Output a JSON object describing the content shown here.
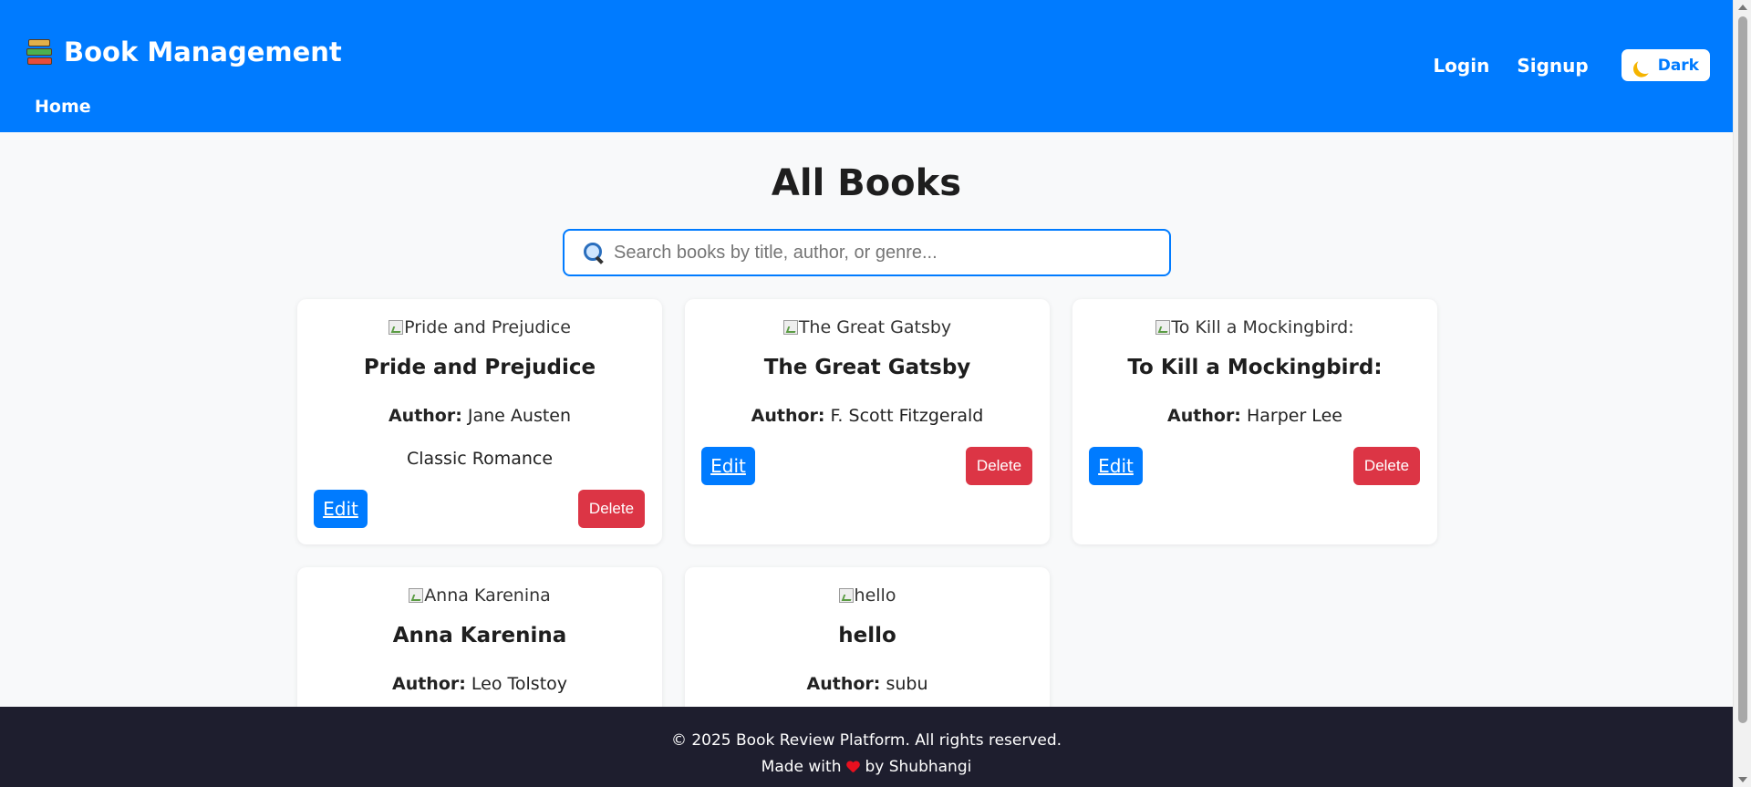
{
  "header": {
    "brand": "Book Management",
    "nav_home": "Home",
    "login": "Login",
    "signup": "Signup",
    "theme_toggle": "Dark",
    "bg_color": "#007bff"
  },
  "main": {
    "title": "All Books",
    "search": {
      "placeholder": "Search books by title, author, or genre...",
      "value": ""
    },
    "author_label": "Author:",
    "edit_label": "Edit",
    "delete_label": "Delete",
    "books": [
      {
        "img_alt": "Pride and Prejudice",
        "title": "Pride and Prejudice",
        "author": "Jane Austen",
        "genre": "Classic Romance"
      },
      {
        "img_alt": "The Great Gatsby",
        "title": "The Great Gatsby",
        "author": "F. Scott Fitzgerald",
        "genre": ""
      },
      {
        "img_alt": "To Kill a Mockingbird:",
        "title": "To Kill a Mockingbird:",
        "author": "Harper Lee",
        "genre": ""
      },
      {
        "img_alt": "Anna Karenina",
        "title": "Anna Karenina",
        "author": "Leo Tolstoy",
        "genre": ""
      },
      {
        "img_alt": "hello",
        "title": "hello",
        "author": "subu",
        "genre": ""
      }
    ]
  },
  "footer": {
    "copyright": "© 2025 Book Review Platform. All rights reserved.",
    "made_with_prefix": "Made with",
    "made_with_suffix": "by Shubhangi"
  },
  "colors": {
    "primary": "#007bff",
    "danger": "#dc3545",
    "footer_bg": "#1e1e2e"
  }
}
